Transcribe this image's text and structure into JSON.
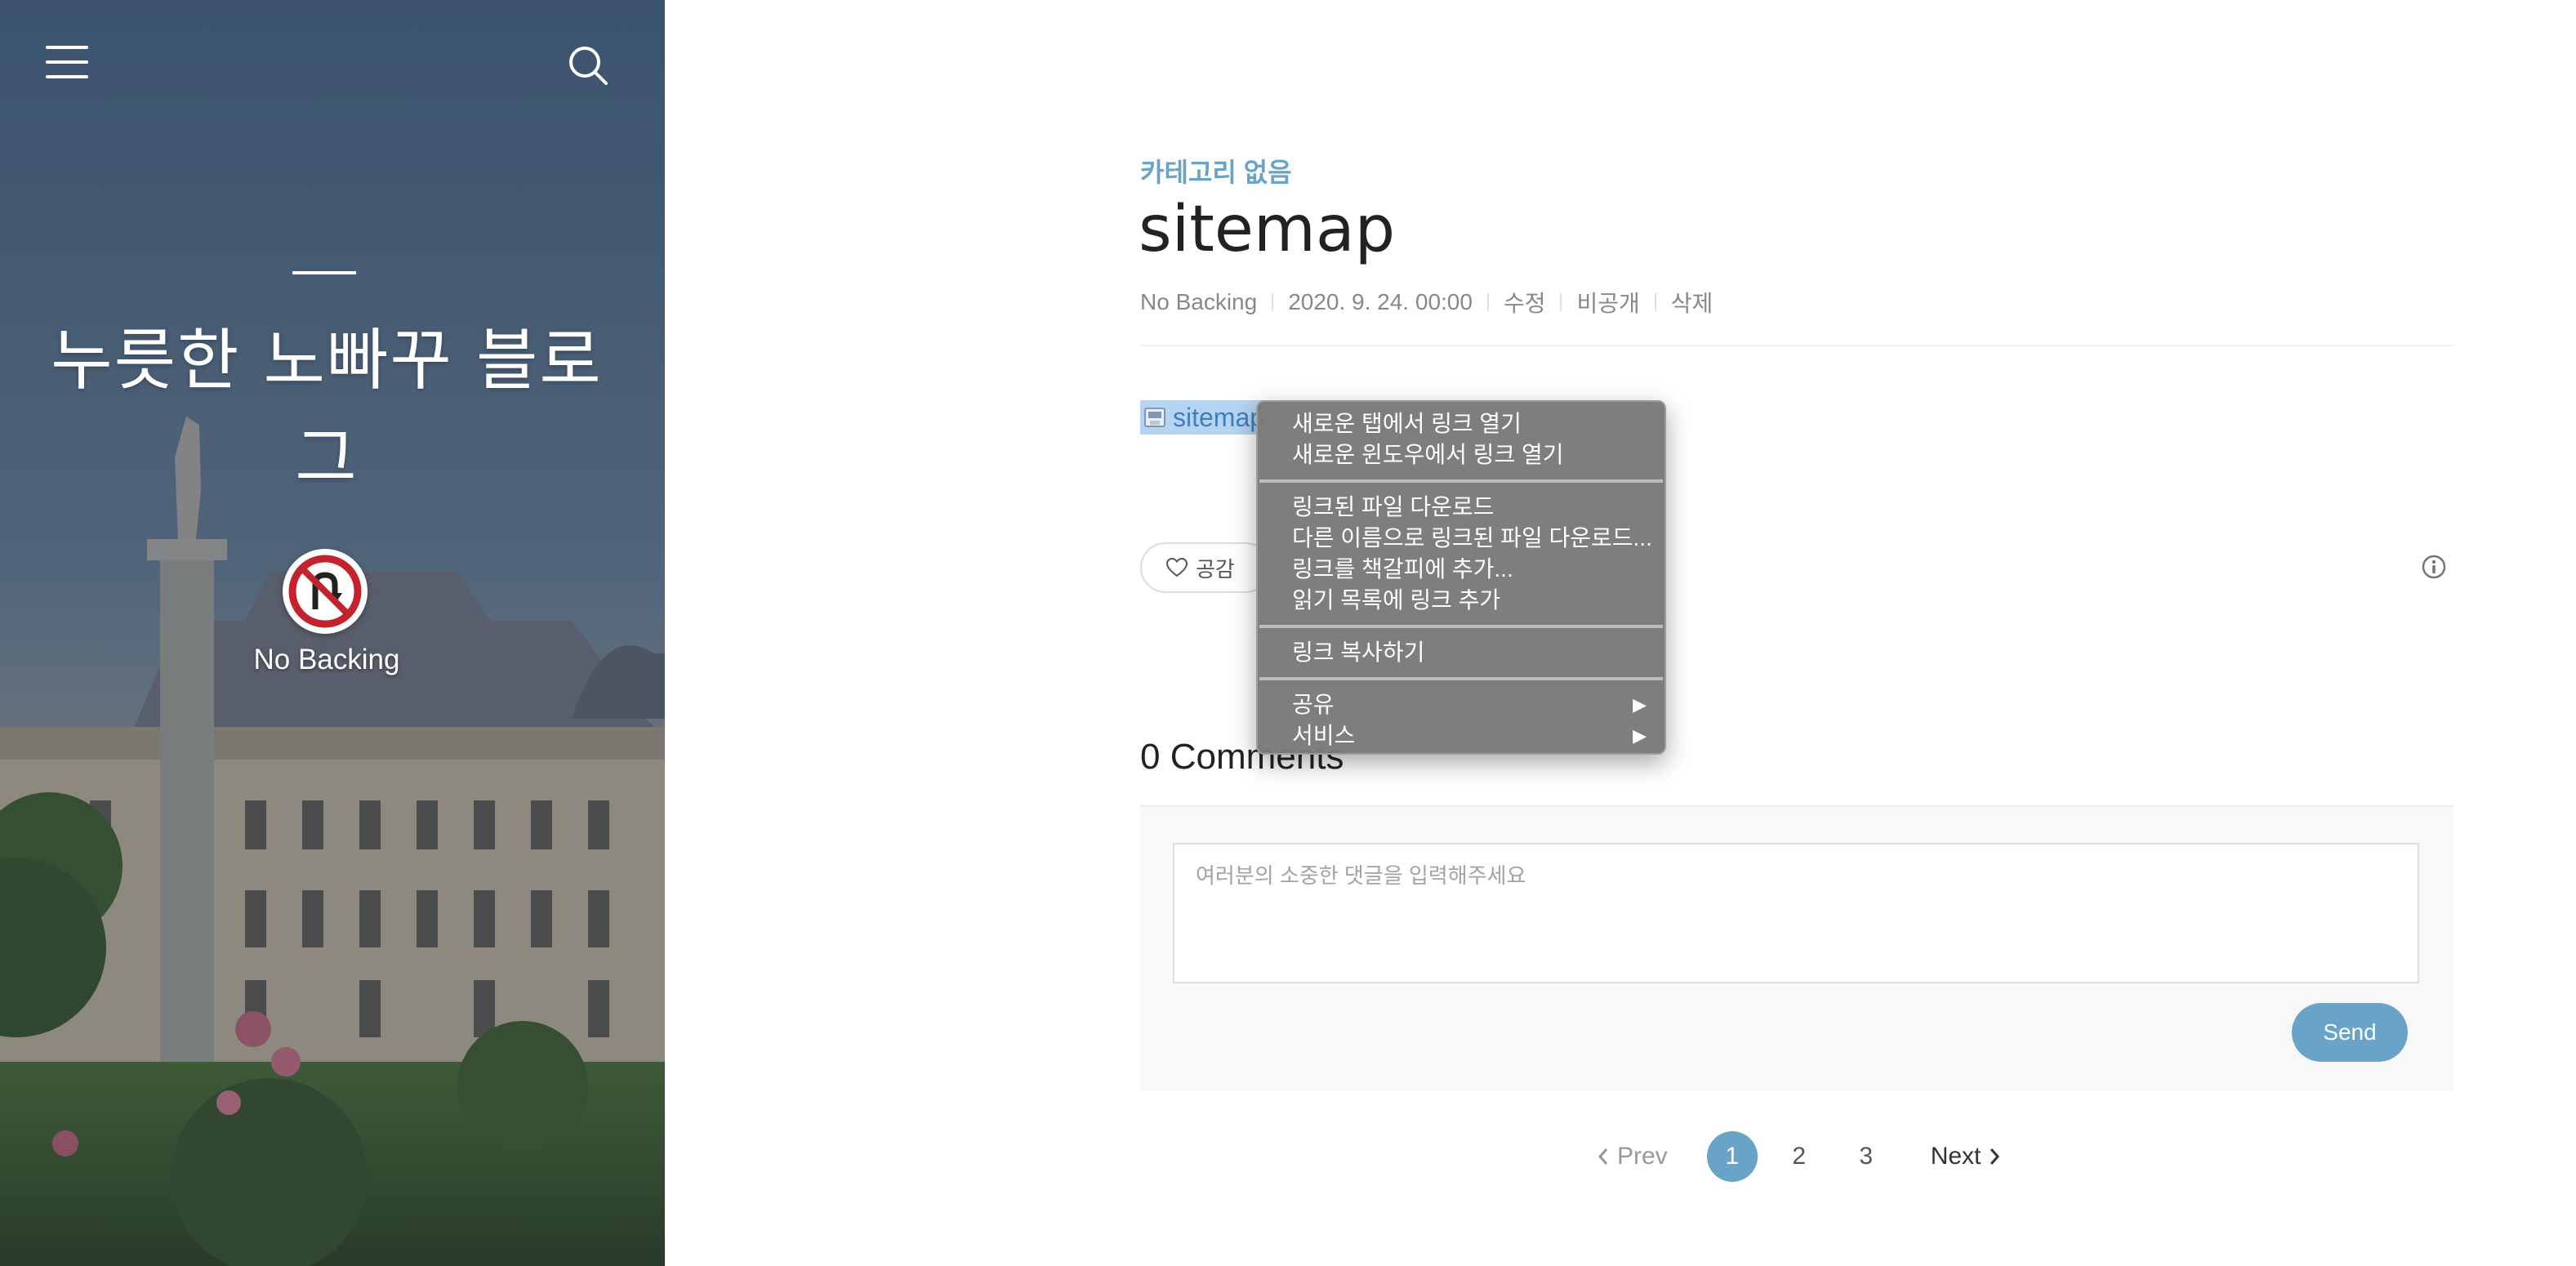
{
  "sidebar": {
    "blog_title": "누릇한 노빠꾸 블로그",
    "author_name": "No Backing"
  },
  "post": {
    "category": "카테고리 없음",
    "title": "sitemap",
    "meta": {
      "author": "No Backing",
      "date": "2020. 9. 24. 00:00",
      "edit": "수정",
      "private": "비공개",
      "delete": "삭제"
    },
    "attachment": "sitemap",
    "like_label": "공감"
  },
  "context_menu": {
    "items": [
      "새로운 탭에서 링크 열기",
      "새로운 윈도우에서 링크 열기",
      "링크된 파일 다운로드",
      "다른 이름으로 링크된 파일 다운로드...",
      "링크를 책갈피에 추가...",
      "읽기 목록에 링크 추가",
      "링크 복사하기",
      "공유",
      "서비스"
    ]
  },
  "comments": {
    "heading": "0 Comments",
    "placeholder": "여러분의 소중한 댓글을 입력해주세요",
    "send_label": "Send"
  },
  "pagination": {
    "prev": "Prev",
    "pages": [
      "1",
      "2",
      "3"
    ],
    "next": "Next"
  },
  "colors": {
    "accent": "#6aa3c8",
    "link_highlight": "#b6d3f2",
    "menu_bg": "#7a7a7a"
  }
}
